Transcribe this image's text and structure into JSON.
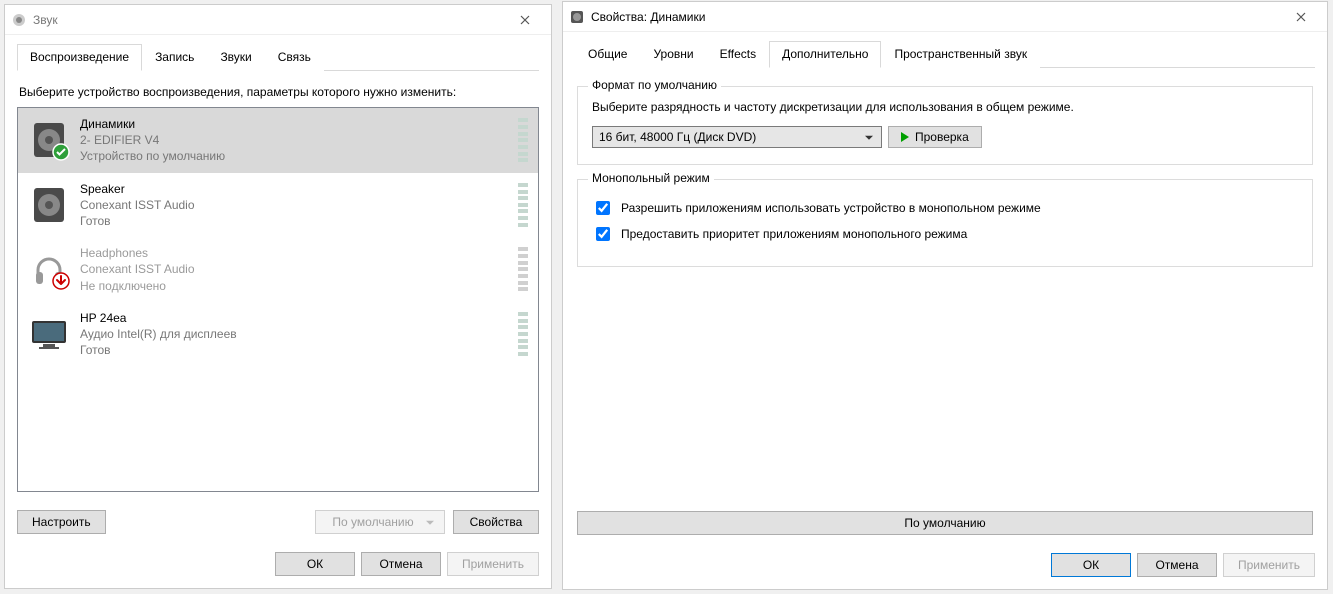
{
  "window1": {
    "title": "Звук",
    "tabs": [
      "Воспроизведение",
      "Запись",
      "Звуки",
      "Связь"
    ],
    "active_tab": 0,
    "instruction": "Выберите устройство воспроизведения, параметры которого нужно изменить:",
    "devices": [
      {
        "name": "Динамики",
        "sub": "2- EDIFIER V4",
        "status": "Устройство по умолчанию",
        "selected": true,
        "kind": "speaker",
        "default": true
      },
      {
        "name": "Speaker",
        "sub": "Conexant ISST Audio",
        "status": "Готов",
        "selected": false,
        "kind": "speaker",
        "default": false
      },
      {
        "name": "Headphones",
        "sub": "Conexant ISST Audio",
        "status": "Не подключено",
        "selected": false,
        "kind": "headphones",
        "disabled": true
      },
      {
        "name": "HP 24ea",
        "sub": "Аудио Intel(R) для дисплеев",
        "status": "Готов",
        "selected": false,
        "kind": "monitor",
        "default": false
      }
    ],
    "buttons": {
      "configure": "Настроить",
      "set_default": "По умолчанию",
      "properties": "Свойства",
      "ok": "ОК",
      "cancel": "Отмена",
      "apply": "Применить"
    }
  },
  "window2": {
    "title": "Свойства: Динамики",
    "tabs": [
      "Общие",
      "Уровни",
      "Effects",
      "Дополнительно",
      "Пространственный звук"
    ],
    "active_tab": 3,
    "default_format": {
      "legend": "Формат по умолчанию",
      "desc": "Выберите разрядность и частоту дискретизации для использования в общем режиме.",
      "selected": "16 бит, 48000 Гц (Диск DVD)",
      "test_button": "Проверка"
    },
    "exclusive": {
      "legend": "Монопольный режим",
      "opt1": "Разрешить приложениям использовать устройство в монопольном режиме",
      "opt2": "Предоставить приоритет приложениям монопольного режима"
    },
    "buttons": {
      "restore_defaults": "По умолчанию",
      "ok": "ОК",
      "cancel": "Отмена",
      "apply": "Применить"
    }
  }
}
